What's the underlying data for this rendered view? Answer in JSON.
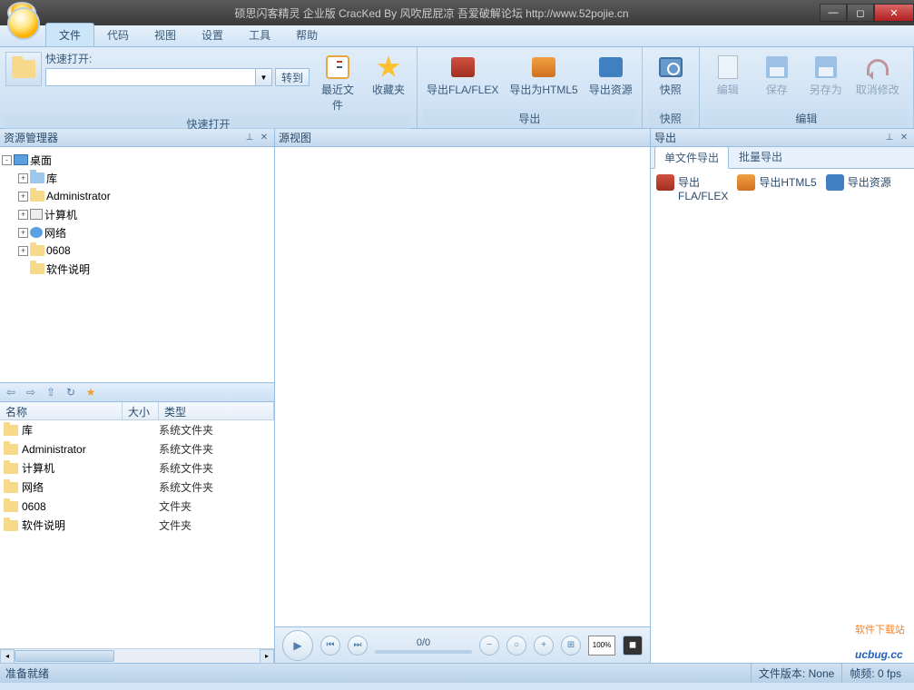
{
  "title": "硕思闪客精灵 企业版   CracKed By 风吹屁屁凉   吾爱破解论坛 http://www.52pojie.cn",
  "menu": {
    "items": [
      "文件",
      "代码",
      "视图",
      "设置",
      "工具",
      "帮助"
    ],
    "active": 0
  },
  "ribbon": {
    "quick_open": {
      "label": "快速打开:",
      "goto": "转到",
      "group_label": "快速打开"
    },
    "recent": "最近文件",
    "fav": "收藏夹",
    "export": {
      "fla": "导出FLA/FLEX",
      "html5": "导出为HTML5",
      "res": "导出资源",
      "group_label": "导出"
    },
    "snap": {
      "btn": "快照",
      "group_label": "快照"
    },
    "edit": {
      "edit": "编辑",
      "save": "保存",
      "saveas": "另存为",
      "undo": "取消修改",
      "group_label": "编辑"
    }
  },
  "left": {
    "header": "资源管理器",
    "tree": [
      {
        "depth": 0,
        "exp": "-",
        "icon": "desktop",
        "label": "桌面"
      },
      {
        "depth": 1,
        "exp": "+",
        "icon": "folder-blue",
        "label": "库"
      },
      {
        "depth": 1,
        "exp": "+",
        "icon": "user",
        "label": "Administrator"
      },
      {
        "depth": 1,
        "exp": "+",
        "icon": "comp",
        "label": "计算机"
      },
      {
        "depth": 1,
        "exp": "+",
        "icon": "net",
        "label": "网络"
      },
      {
        "depth": 1,
        "exp": "+",
        "icon": "folder",
        "label": "0608"
      },
      {
        "depth": 1,
        "exp": "",
        "icon": "folder",
        "label": "软件说明"
      }
    ],
    "list": {
      "cols": {
        "name": "名称",
        "size": "大小",
        "type": "类型"
      },
      "rows": [
        {
          "name": "库",
          "type": "系统文件夹",
          "icon": "folder"
        },
        {
          "name": "Administrator",
          "type": "系统文件夹",
          "icon": "user"
        },
        {
          "name": "计算机",
          "type": "系统文件夹",
          "icon": "folder"
        },
        {
          "name": "网络",
          "type": "系统文件夹",
          "icon": "folder"
        },
        {
          "name": "0608",
          "type": "文件夹",
          "icon": "folder"
        },
        {
          "name": "软件说明",
          "type": "文件夹",
          "icon": "folder"
        }
      ]
    }
  },
  "mid": {
    "header": "源视图",
    "progress": "0/0"
  },
  "right": {
    "header": "导出",
    "tabs": [
      "单文件导出",
      "批量导出"
    ],
    "active_tab": 0,
    "items": [
      {
        "label": "导出\nFLA/FLEX"
      },
      {
        "label": "导出HTML5"
      },
      {
        "label": "导出资源"
      }
    ]
  },
  "status": {
    "ready": "准备就绪",
    "version_lbl": "文件版本:",
    "version": "None",
    "fps_lbl": "帧频:",
    "fps": "0 fps"
  },
  "watermark": {
    "small": "软件下载站",
    "big": "ucbug.cc"
  }
}
